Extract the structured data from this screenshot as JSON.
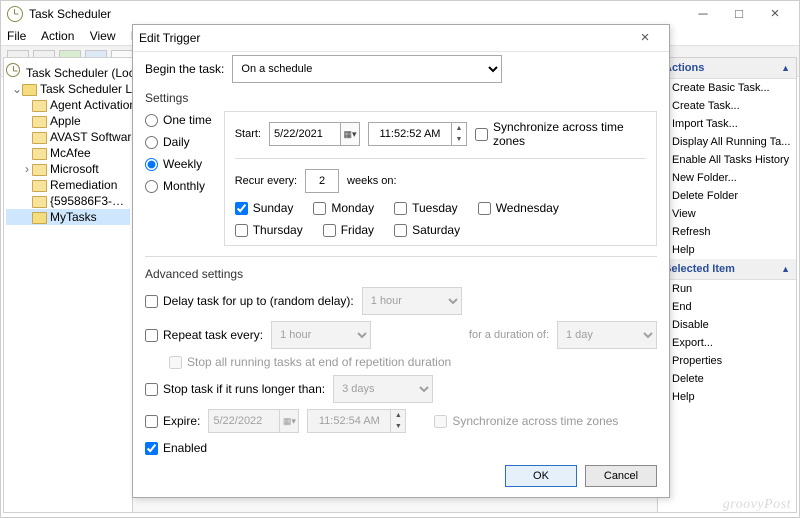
{
  "main": {
    "title": "Task Scheduler",
    "menu": [
      "File",
      "Action",
      "View",
      "Help"
    ],
    "tree": {
      "root": "Task Scheduler (Local)",
      "lib": "Task Scheduler Library",
      "items": [
        "Agent Activation",
        "Apple",
        "AVAST Software",
        "McAfee",
        "Microsoft",
        "Remediation",
        "{595886F3-…",
        "MyTasks"
      ]
    },
    "actions_hdr": "Actions",
    "actions1": [
      "Create Basic Task...",
      "Create Task...",
      "Import Task...",
      "Display All Running Ta...",
      "Enable All Tasks History",
      "New Folder...",
      "Delete Folder",
      "View",
      "Refresh",
      "Help"
    ],
    "sel_hdr": "Selected Item",
    "actions2": [
      "Run",
      "End",
      "Disable",
      "Export...",
      "Properties",
      "Delete",
      "Help"
    ]
  },
  "dlg": {
    "title": "Edit Trigger",
    "begin_label": "Begin the task:",
    "begin_value": "On a schedule",
    "settings_label": "Settings",
    "options": {
      "one": "One time",
      "daily": "Daily",
      "weekly": "Weekly",
      "monthly": "Monthly"
    },
    "start_label": "Start:",
    "start_date": "5/22/2021",
    "start_time": "11:52:52 AM",
    "sync_tz": "Synchronize across time zones",
    "recur_label": "Recur every:",
    "recur_value": "2",
    "weeks_on": "weeks on:",
    "days": {
      "sun": "Sunday",
      "mon": "Monday",
      "tue": "Tuesday",
      "wed": "Wednesday",
      "thu": "Thursday",
      "fri": "Friday",
      "sat": "Saturday"
    },
    "adv_label": "Advanced settings",
    "delay_label": "Delay task for up to (random delay):",
    "delay_value": "1 hour",
    "repeat_label": "Repeat task every:",
    "repeat_value": "1 hour",
    "duration_label": "for a duration of:",
    "duration_value": "1 day",
    "stop_end_label": "Stop all running tasks at end of repetition duration",
    "stop_longer_label": "Stop task if it runs longer than:",
    "stop_longer_value": "3 days",
    "expire_label": "Expire:",
    "expire_date": "5/22/2022",
    "expire_time": "11:52:54 AM",
    "sync_tz2": "Synchronize across time zones",
    "enabled_label": "Enabled",
    "ok": "OK",
    "cancel": "Cancel"
  },
  "watermark": "groovyPost"
}
